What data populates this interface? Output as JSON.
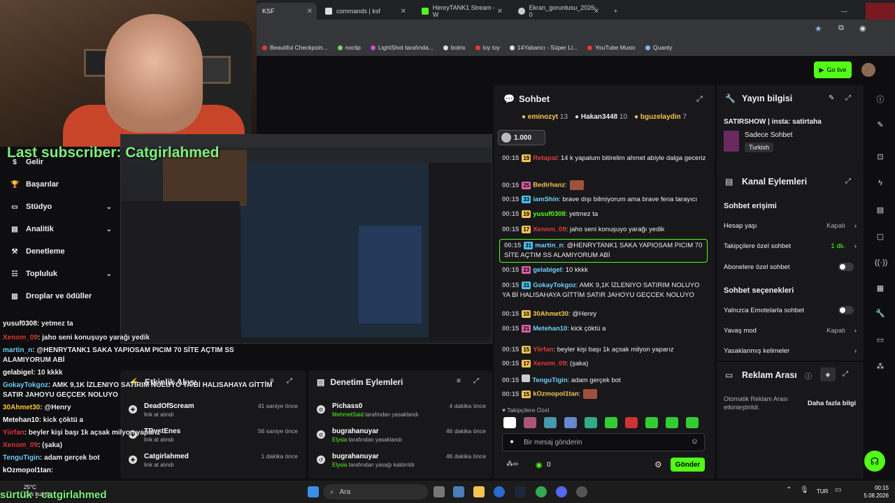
{
  "browser": {
    "tabs": [
      {
        "label": "KSF",
        "active": true
      },
      {
        "label": "commands | ksf",
        "active": false
      },
      {
        "label": "HenryTANK1 Stream - W",
        "active": false
      },
      {
        "label": "Ekran_goruntusu_2026-0",
        "active": false
      }
    ],
    "bookmarks": [
      "Beautiful Checkpoin...",
      "noclip",
      "LightShot tarafında...",
      "botrix",
      "loy loy",
      "14Yabancı - Süper Li...",
      "YouTube Music",
      "Quanty"
    ]
  },
  "overlay": {
    "last_subscriber": "Last subscriber: Catgirlahmed",
    "ticker": "sürtük : catgirlahmed"
  },
  "header": {
    "go_live": "Go live"
  },
  "sidenav": {
    "items": [
      {
        "label": "Gelir",
        "expandable": false
      },
      {
        "label": "Başarılar",
        "expandable": false
      },
      {
        "label": "Stüdyo",
        "expandable": true
      },
      {
        "label": "Analitik",
        "expandable": true
      },
      {
        "label": "Denetleme",
        "expandable": false
      },
      {
        "label": "Topluluk",
        "expandable": true
      },
      {
        "label": "Droplar ve ödüller",
        "expandable": false
      }
    ]
  },
  "overlay_chat": [
    {
      "user": "yusuf0308",
      "text": ": yetmez ta",
      "color": "#ffffff"
    },
    {
      "user": "Xenom_09",
      "text": ": jaho seni konuşuyo yarağı yedik",
      "color": "#e23a3a"
    },
    {
      "user": "martin_n",
      "text": ": @HENRYTANK1 SAKA YAPIOSAM PICIM 70 SİTE AÇTIM SS",
      "color": "#6fd0ff"
    },
    {
      "user": "",
      "text": "ALAMIYORUM ABİ",
      "color": "#ffffff"
    },
    {
      "user": "gelabigel",
      "text": ": 10 kkkk",
      "color": "#ffffff"
    },
    {
      "user": "GokayTokgoz",
      "text": ": AMK 9,1K İZLENIYO SATIRIM NOLUYO YA Bİ HALISAHAYA GİTTİM",
      "color": "#6fd0ff"
    },
    {
      "user": "",
      "text": "SATIR JAHOYU GEÇCEK NOLUYO",
      "color": "#ffffff"
    },
    {
      "user": "30Ahmet30",
      "text": ": @Henry",
      "color": "#ffcc33"
    },
    {
      "user": "Metehan10",
      "text": ": kick çöktü a",
      "color": "#ffffff"
    },
    {
      "user": "Yiirfan",
      "text": ": beyler kişi başı 1k açsak milyon yaparız",
      "color": "#e23a3a"
    },
    {
      "user": "Xenom_09",
      "text": ": (şaka)",
      "color": "#e23a3a"
    },
    {
      "user": "TenguTigin",
      "text": ": adam gerçek bot",
      "color": "#6fd0ff"
    },
    {
      "user": "kOzmopol1tan",
      "text": ":",
      "color": "#ffffff"
    }
  ],
  "activity": {
    "title": "Etkinlik Akışı",
    "rows": [
      {
        "name": "DeadOfScream",
        "sub": "link at alındı",
        "time": "41 saniye önce"
      },
      {
        "name": "TRustEnes",
        "sub": "link at alındı",
        "time": "56 saniye önce"
      },
      {
        "name": "Catgirlahmed",
        "sub": "link at alındı",
        "time": "1 dakika önce"
      }
    ]
  },
  "moderation": {
    "title": "Denetim Eylemleri",
    "rows": [
      {
        "name": "Pichass0",
        "actor": "MehmetSaid",
        "action": "tarafından yasaklandı",
        "time": "4 dakika önce"
      },
      {
        "name": "bugrahanuyar",
        "actor": "Elysia",
        "action": "tarafından yasaklandı",
        "time": "46 dakika önce"
      },
      {
        "name": "bugrahanuyar",
        "actor": "Elysia",
        "action": "tarafından yasağı kaldırıldı",
        "time": "46 dakika önce"
      }
    ]
  },
  "chat": {
    "title": "Sohbet",
    "gifters": [
      {
        "name": "eminozyt",
        "count": "13",
        "color": "#f5c451"
      },
      {
        "name": "Hakan3448",
        "count": "10",
        "color": "#ffffff"
      },
      {
        "name": "bguzelaydin",
        "count": "7",
        "color": "#f5c451"
      }
    ],
    "pinned_amount": "1.000",
    "messages": [
      {
        "time": "00:15",
        "badge": "19",
        "badgeColor": "#f5c451",
        "user": "Retapai",
        "userColor": "#e23a3a",
        "text": ": 14 k yapalum bitirelim ahmet abiyle dalga geceriz",
        "hl": false
      },
      {
        "time": "00:15",
        "badge": "25",
        "badgeColor": "#e05fa6",
        "user": "Bedirhanz",
        "userColor": "#f5c451",
        "text": ":",
        "hl": false,
        "emote": true
      },
      {
        "time": "00:15",
        "badge": "33",
        "badgeColor": "#4ac1f0",
        "user": "iamShin",
        "userColor": "#6fd0ff",
        "text": ": brave dışı bilmiyorum ama brave fena tarayıcı",
        "hl": false
      },
      {
        "time": "00:15",
        "badge": "19",
        "badgeColor": "#f5c451",
        "user": "yusuf0308",
        "userColor": "#53fc18",
        "text": ": yetmez ta",
        "hl": false
      },
      {
        "time": "00:15",
        "badge": "17",
        "badgeColor": "#f5c451",
        "user": "Xenom_09",
        "userColor": "#e23a3a",
        "text": ": jaho seni konuşuyo yarağı yedik",
        "hl": false
      },
      {
        "time": "00:15",
        "badge": "31",
        "badgeColor": "#4ac1f0",
        "user": "martin_n",
        "userColor": "#6fd0ff",
        "text": ": @HENRYTANK1 SAKA YAPIOSAM PICIM 70 SİTE AÇTIM SS ALAMIYORUM ABİ",
        "hl": true
      },
      {
        "time": "00:15",
        "badge": "23",
        "badgeColor": "#e05fa6",
        "user": "gelabigel",
        "userColor": "#6fd0ff",
        "text": ": 10 kkkk",
        "hl": false
      },
      {
        "time": "00:15",
        "badge": "31",
        "badgeColor": "#4ac1f0",
        "user": "GokayTokgoz",
        "userColor": "#6fd0ff",
        "text": ": AMK 9,1K İZLENIYO SATIRIM NOLUYO YA Bİ HALISAHAYA GİTTİM SATIR JAHOYU GEÇCEK NOLUYO",
        "hl": false
      },
      {
        "time": "00:15",
        "badge": "10",
        "badgeColor": "#f5c451",
        "user": "30Ahmet30",
        "userColor": "#f5c451",
        "text": ": @Henry",
        "hl": false
      },
      {
        "time": "00:15",
        "badge": "21",
        "badgeColor": "#e05fa6",
        "user": "Metehan10",
        "userColor": "#6fd0ff",
        "text": ": kick çöktü a",
        "hl": false
      },
      {
        "time": "00:15",
        "badge": "15",
        "badgeColor": "#f5c451",
        "user": "Yiirfan",
        "userColor": "#e23a3a",
        "text": ": beyler kişi başı 1k açsak milyon yaparız",
        "hl": false
      },
      {
        "time": "00:15",
        "badge": "17",
        "badgeColor": "#f5c451",
        "user": "Xenom_09",
        "userColor": "#e23a3a",
        "text": ": (şaka)",
        "hl": false
      },
      {
        "time": "00:15",
        "badge": "",
        "badgeColor": "#cccccc",
        "user": "TenguTigin",
        "userColor": "#6fd0ff",
        "text": ": adam gerçek bot",
        "hl": false
      },
      {
        "time": "00:15",
        "badge": "15",
        "badgeColor": "#f5c451",
        "user": "kOzmopol1tan",
        "userColor": "#f5c451",
        "text": ":",
        "hl": false,
        "emote": true
      }
    ],
    "followers_only": "Takipçilere Özel",
    "input_placeholder": "Bir mesaj gönderin",
    "points": "0",
    "send_label": "Gönder"
  },
  "stream_info": {
    "title": "Yayın bilgisi",
    "stream_title": "SATIRSHOW | insta: satirtaha",
    "category": "Sadece Sohbet",
    "tag": "Turkish"
  },
  "channel_actions": {
    "title": "Kanal Eylemleri",
    "access_title": "Sohbet erişimi",
    "account_age": {
      "label": "Hesap yaşı",
      "value": "Kapalı"
    },
    "followers_chat": {
      "label": "Takipçilere özel sohbet",
      "value": "1 dk."
    },
    "subs_chat": {
      "label": "Abonelere özel sohbet"
    },
    "options_title": "Sohbet seçenekleri",
    "emote_only": {
      "label": "Yalnızca Emotelarla sohbet"
    },
    "slow_mode": {
      "label": "Yavaş mod",
      "value": "Kapalı"
    },
    "banned_words": {
      "label": "Yasaklanmış kelimeler"
    }
  },
  "ad_break": {
    "title": "Reklam Arası",
    "desc": "Otomatik Reklam Arası etkinleştirildi.",
    "more": "Daha fazla bilgi"
  },
  "taskbar": {
    "weather_temp": "25°C",
    "weather_desc": "Çok bulutlu",
    "search": "Ara",
    "lang": "TUR",
    "time": "00:15",
    "date": "5.08.2026"
  },
  "colors": {
    "accent": "#53fc18",
    "panel": "#18181b",
    "bg": "#0e0e10"
  }
}
